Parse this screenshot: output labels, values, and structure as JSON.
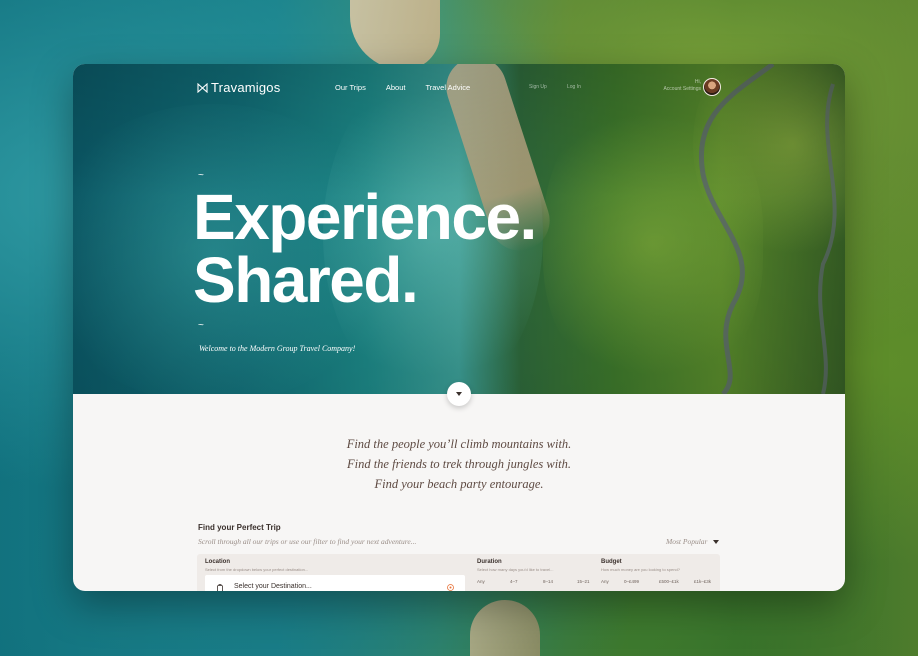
{
  "brand": {
    "name": "Travamigos",
    "logo_icon": "ribbon-logo-icon"
  },
  "nav": {
    "links": [
      "Our Trips",
      "About",
      "Travel Advice"
    ],
    "small_links": [
      "Sign Up",
      "Log In"
    ],
    "account": {
      "line1": "Hi,",
      "line2": "Account",
      "line3": "Settings"
    }
  },
  "hero": {
    "tilde_top": "~",
    "headline_line1": "Experience.",
    "headline_line2": "Shared.",
    "tilde_bottom": "~",
    "subtitle": "Welcome to the Modern Group Travel Company!"
  },
  "tagline": [
    "Find the people you’ll climb mountains with.",
    "Find the friends to trek through jungles with.",
    "Find your beach party entourage."
  ],
  "trip_finder": {
    "title": "Find your Perfect Trip",
    "subtitle": "Scroll through all our trips or use our filter to find your next adventure...",
    "sort_label": "Most Popular",
    "location": {
      "title": "Location",
      "hint": "Select from the dropdown below your perfect destination...",
      "placeholder": "Select your Destination..."
    },
    "duration": {
      "title": "Duration",
      "hint": "Select how many days you’d like to travel...",
      "options": [
        "Any",
        "4–7",
        "8–14",
        "15–21"
      ]
    },
    "budget": {
      "title": "Budget",
      "hint": "How much money are you looking to spend?",
      "options": [
        "Any",
        "0–£499",
        "£500–£1k",
        "£1k–£3k"
      ]
    }
  },
  "colors": {
    "accent": "#e8733a",
    "text_dark": "#3a302c",
    "text_serif": "#5e4a42"
  }
}
